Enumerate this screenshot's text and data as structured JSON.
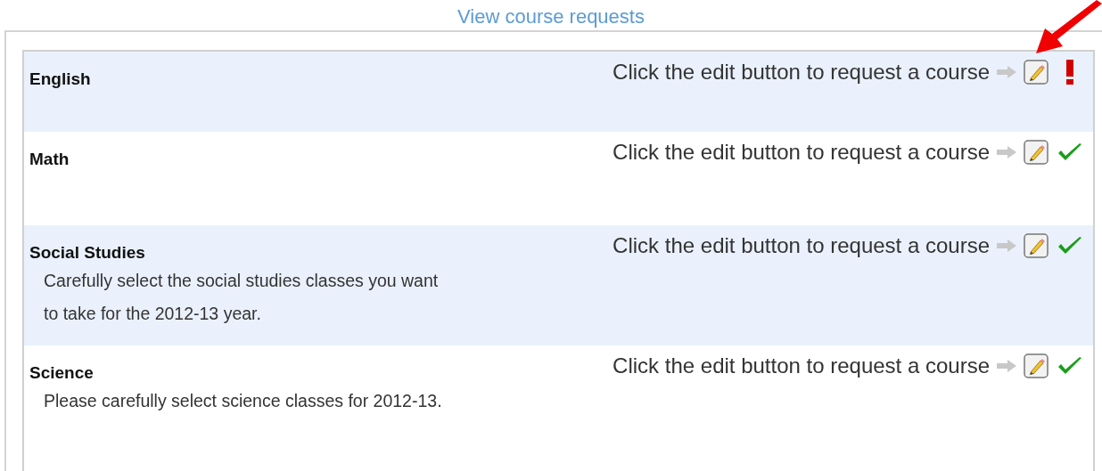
{
  "link": "View course requests",
  "courses": [
    {
      "title": "English",
      "instruction": "Click the edit button to request a course",
      "complete": false
    },
    {
      "title": "Math",
      "instruction": "Click the edit button to request a course",
      "complete": true
    },
    {
      "title": "Social Studies",
      "description": "Carefully select the social studies classes you want to take for the 2012-13 year.",
      "instruction": "Click the edit button to request a course",
      "complete": true
    },
    {
      "title": "Science",
      "description": "Please carefully select science classes for 2012-13.",
      "instruction": "Click the edit button to request a course",
      "complete": true
    }
  ]
}
